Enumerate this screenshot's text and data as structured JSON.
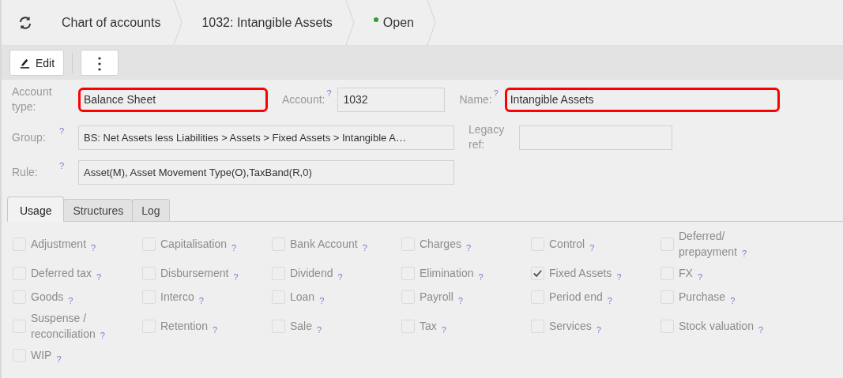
{
  "breadcrumbs": [
    {
      "label": "Chart of accounts"
    },
    {
      "label": "1032: Intangible Assets"
    }
  ],
  "status": {
    "label": "Open",
    "color": "#2e9e3a"
  },
  "toolbar": {
    "edit_button": "Edit",
    "more_button": "⋮"
  },
  "fields": [
    {
      "label": "Account type:",
      "value": "Balance Sheet",
      "highlighted": true
    },
    {
      "label": "Account:",
      "value": "1032",
      "help": "?",
      "highlighted": false
    },
    {
      "label": "Name:",
      "value": "Intangible Assets",
      "help": "?",
      "highlighted": true
    },
    {
      "label": "Group:",
      "value": "BS: Net Assets less Liabilities > Assets > Fixed Assets > Intangible A…",
      "help": "?",
      "highlighted": false
    },
    {
      "label": "Legacy ref:",
      "highlighted": false
    },
    {
      "label": "Rule:",
      "value": "Asset(M), Asset Movement Type(O),TaxBand(R,0)",
      "help": "?",
      "highlighted": false
    }
  ],
  "tabs": [
    {
      "label": "Usage",
      "selected": true
    },
    {
      "label": "Structures",
      "selected": false
    },
    {
      "label": "Log",
      "selected": false
    }
  ],
  "usage": [
    {
      "label": "Adjustment",
      "help": "?",
      "checked": false
    },
    {
      "label": "Capitalisation",
      "help": "?",
      "checked": false
    },
    {
      "label": "Bank Account",
      "help": "?",
      "checked": false
    },
    {
      "label": "Charges",
      "help": "?",
      "checked": false
    },
    {
      "label": "Control",
      "help": "?",
      "checked": false
    },
    {
      "label": "Deferred/\nprepayment",
      "help": "?",
      "checked": false
    },
    {
      "label": "Deferred tax",
      "help": "?",
      "checked": false
    },
    {
      "label": "Disbursement",
      "help": "?",
      "checked": false
    },
    {
      "label": "Dividend",
      "help": "?",
      "checked": false
    },
    {
      "label": "Elimination",
      "help": "?",
      "checked": false
    },
    {
      "label": "Fixed Assets",
      "help": "?",
      "checked": true
    },
    {
      "label": "FX",
      "help": "?",
      "checked": false
    },
    {
      "label": "Goods",
      "help": "?",
      "checked": false
    },
    {
      "label": "Interco",
      "help": "?",
      "checked": false
    },
    {
      "label": "Loan",
      "help": "?",
      "checked": false
    },
    {
      "label": "Payroll",
      "help": "?",
      "checked": false
    },
    {
      "label": "Period end",
      "help": "?",
      "checked": false
    },
    {
      "label": "Purchase",
      "help": "?",
      "checked": false
    },
    {
      "label": "Suspense /\nreconciliation",
      "help": "?",
      "checked": false
    },
    {
      "label": "Retention",
      "help": "?",
      "checked": false
    },
    {
      "label": "Sale",
      "help": "?",
      "checked": false
    },
    {
      "label": "Tax",
      "help": "?",
      "checked": false
    },
    {
      "label": "Services",
      "help": "?",
      "checked": false
    },
    {
      "label": "Stock valuation",
      "help": "?",
      "checked": false
    },
    {
      "label": "WIP",
      "help": "?",
      "checked": false
    }
  ]
}
